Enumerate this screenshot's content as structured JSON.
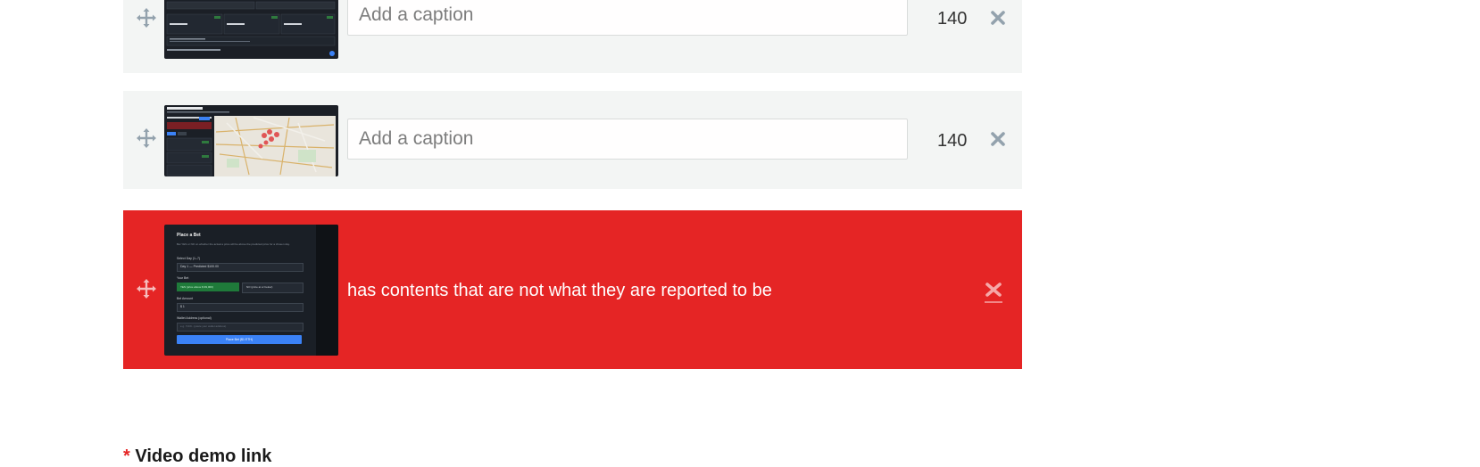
{
  "screenshots": [
    {
      "caption_value": "",
      "caption_placeholder": "Add a caption",
      "char_count": "140",
      "thumb": "dark-dashboard"
    },
    {
      "caption_value": "",
      "caption_placeholder": "Add a caption",
      "char_count": "140",
      "thumb": "map-dashboard"
    }
  ],
  "error_item": {
    "message": "has contents that are not what they are reported to be",
    "thumb_text": {
      "title": "Place a Bet",
      "subtitle": "Bet YES or NO on whether the actual ≥ price will be above the predicted price for a chosen day.",
      "select_label": "Select Day (1–7)",
      "select_value": "Day 1 — Predicted $100.00",
      "your_bet": "Your Bet",
      "yes_btn": "YES (price above $ 99,000)",
      "no_btn": "NO (price at or below)",
      "amount_label": "Bet Amount",
      "amount_value": "$ 1",
      "wallet_label": "Wallet Address (optional)",
      "wallet_placeholder": "e.g. 7xK9...(paste your wallet address)",
      "place_btn": "Place Bet ($1 ETH)"
    }
  },
  "video_field": {
    "required_mark": "*",
    "label": "Video demo link"
  },
  "colors": {
    "error": "#e52525",
    "row_bg": "#f3f5f4",
    "icon": "#93a2ad"
  }
}
